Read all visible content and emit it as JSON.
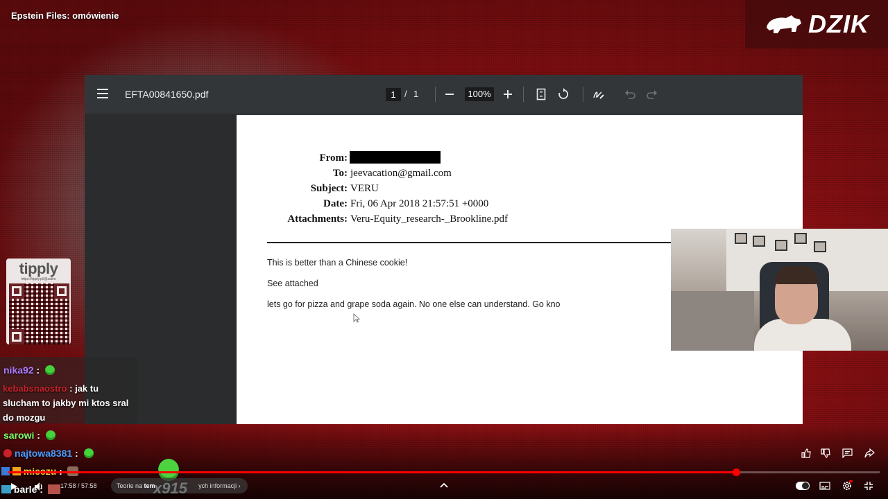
{
  "video": {
    "title": "Epstein Files: omówienie",
    "brand_logo": "DZIK"
  },
  "pdf_viewer": {
    "filename": "EFTA00841650.pdf",
    "page_current": "1",
    "page_separator": "/",
    "page_total": "1",
    "zoom": "100%",
    "icons": [
      "menu-icon",
      "zoom-out-icon",
      "zoom-in-icon",
      "fit-page-icon",
      "rotate-icon",
      "annotate-icon",
      "undo-icon",
      "redo-icon"
    ]
  },
  "email": {
    "from_label": "From:",
    "to_label": "To:",
    "to_value": "jeevacation@gmail.com",
    "subject_label": "Subject:",
    "subject_value": "VERU",
    "date_label": "Date:",
    "date_value": "Fri, 06 Apr 2018 21:57:51 +0000",
    "attachments_label": "Attachments:",
    "attachments_value": "Veru-Equity_research-_Brookline.pdf",
    "body": [
      "This is better than a Chinese cookie!",
      "See attached",
      "lets go for pizza and grape soda again.  No one else can understand.  Go kno"
    ]
  },
  "tipply": {
    "logo": "tipply",
    "url": "https://tipply.pl/@zatiro"
  },
  "chat": {
    "messages": [
      {
        "user": "nika92",
        "sep": ":",
        "text": "",
        "user_color": "#b07cff"
      },
      {
        "user": "kebabsnaostro",
        "sep": ":",
        "text": "jak tu",
        "user_color": "#c8232c"
      },
      {
        "user": "sarowi",
        "sep": ":",
        "text": "",
        "user_color": "#7cff6b"
      },
      {
        "user": "najtowa8381",
        "sep": ":",
        "text": "",
        "user_color": "#4a9cff"
      },
      {
        "user": "mieczu",
        "sep": ":",
        "text": "",
        "user_color": "#ffd23f"
      },
      {
        "user": "barle",
        "sep": ":",
        "text": "",
        "user_color": "#ffffff"
      }
    ],
    "continuation_1": "slucham to jakby mi ktos sral",
    "continuation_2": "do mozgu",
    "highlight_count": "x915"
  },
  "player": {
    "time": "17:58 / 57:58",
    "progress": 0.835,
    "info_prefix": "Teorie na",
    "info_bold": "tem",
    "info_suffix": "ych informacji",
    "colors": {
      "progress": "#ff0000",
      "accent": "#b3181c"
    }
  }
}
